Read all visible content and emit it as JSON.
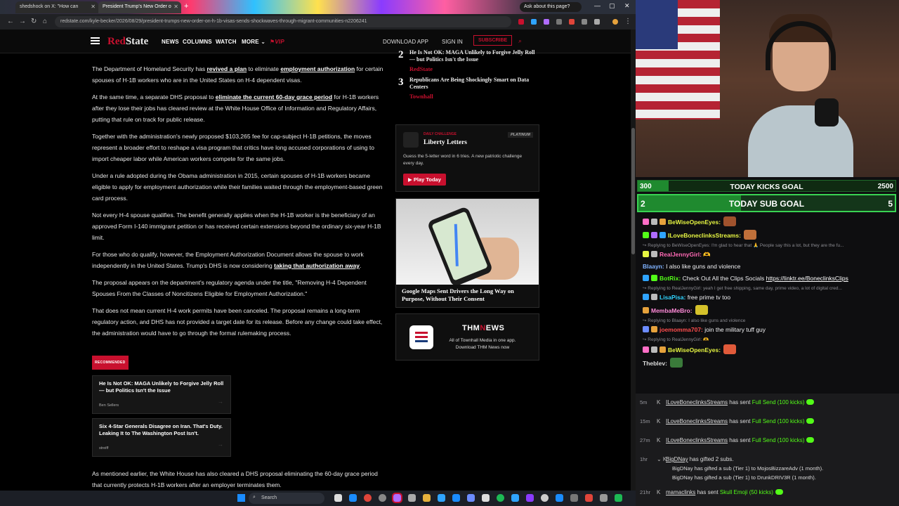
{
  "browser": {
    "tabs": [
      {
        "label": "shedshock on X: \"How can"
      },
      {
        "label": "President Trump's New Order o"
      }
    ],
    "new_tab": "+",
    "ask_pill": "Ask about this page?",
    "url": "redstate.com/kyle-becker/2026/08/29/president-trumps-new-order-on-h-1b-visas-sends-shockwaves-through-migrant-communities-n2206241",
    "window_controls": {
      "minimize": "—",
      "maximize": "▢",
      "close": "✕"
    }
  },
  "site": {
    "logo_red": "Red",
    "logo_white": "State",
    "nav": [
      "NEWS",
      "COLUMNS",
      "WATCH",
      "MORE"
    ],
    "vip": "VIP",
    "download_app": "DOWNLOAD APP",
    "sign_in": "SIGN IN",
    "subscribe": "SUBSCRIBE"
  },
  "article": {
    "p1_a": "The Department of Homeland Security has ",
    "p1_link1": "revived a plan",
    "p1_b": " to eliminate ",
    "p1_link2": "employment authorization",
    "p1_c": " for certain spouses of H-1B workers who are in the United States on H-4 dependent visas.",
    "p2_a": "At the same time, a separate DHS proposal to ",
    "p2_link": "eliminate the current 60-day grace period",
    "p2_b": " for H-1B workers after they lose their jobs has cleared review at the White House Office of Information and Regulatory Affairs, putting that rule on track for public release.",
    "p3": "Together with the administration's newly proposed $103,265 fee for cap-subject H-1B petitions, the moves represent a broader effort to reshape a visa program that critics have long accused corporations of using to import cheaper labor while American workers compete for the same jobs.",
    "p4": "Under a rule adopted during the Obama administration in 2015, certain spouses of H-1B workers became eligible to apply for employment authorization while their families waited through the employment-based green card process.",
    "p5": "Not every H-4 spouse qualifies. The benefit generally applies when the H-1B worker is the beneficiary of an approved Form I-140 immigrant petition or has received certain extensions beyond the ordinary six-year H-1B limit.",
    "p6_a": "For those who do qualify, however, the Employment Authorization Document allows the spouse to work independently in the United States. Trump's DHS is now considering ",
    "p6_link": "taking that authorization away",
    "p6_b": ".",
    "p7": "The proposal appears on the department's regulatory agenda under the title, \"Removing H-4 Dependent Spouses From the Classes of Noncitizens Eligible for Employment Authorization.\"",
    "p8": "That does not mean current H-4 work permits have been canceled. The proposal remains a long-term regulatory action, and DHS has not provided a target date for its release. Before any change could take effect, the administration would have to go through the formal rulemaking process.",
    "recommended_badge": "RECOMMENDED",
    "recommended": [
      {
        "title": "He Is Not OK: MAGA Unlikely to Forgive Jelly Roll — but Politics Isn't the Issue",
        "author": "Ben Sellers"
      },
      {
        "title": "Six 4-Star Generals Disagree on Iran. That's Duty. Leaking It to The Washington Post Isn't.",
        "author": "streiff"
      }
    ],
    "after_rec": "As mentioned earlier, the White House has also cleared a DHS proposal eliminating the 60-day grace period that currently protects H-1B workers after an employer terminates them."
  },
  "rail": {
    "trending": [
      {
        "num": "2",
        "headline": "He Is Not OK: MAGA Unlikely to Forgive Jelly Roll — but Politics Isn't the Issue",
        "source": "RedState"
      },
      {
        "num": "3",
        "headline": "Republicans Are Being Shockingly Smart on Data Centers",
        "source": "Townhall"
      }
    ],
    "liberty": {
      "kicker": "DAILY CHALLENGE",
      "title": "Liberty Letters",
      "platinum": "PLATINUM",
      "desc": "Guess the 5-letter word in 6 tries. A new patriotic challenge every day.",
      "play": "▶ Play Today"
    },
    "map_story": "Google Maps Sent Drivers the Long Way on Purpose, Without Their Consent",
    "thm": {
      "name_a": "THM",
      "name_b": "N",
      "name_c": "EWS",
      "tagline": "All of Townhall Media in one app. Download THM News now"
    }
  },
  "stream": {
    "kicks_goal": {
      "current": "300",
      "label": "TODAY KICKS GOAL",
      "target": "2500",
      "progress": 0.12
    },
    "sub_goal": {
      "current": "2",
      "label": "TODAY SUB GOAL",
      "target": "5",
      "progress": 0.4
    },
    "chat": [
      {
        "type": "msg",
        "user": "BeWiseOpenEyes:",
        "text": "",
        "color": "#e6f542",
        "badges": [
          "#ff6ec7",
          "#bbbbbb",
          "#e6a23c"
        ],
        "emote": "#a0522d"
      },
      {
        "type": "msg",
        "user": "ILoveBoneclinksStreams:",
        "text": "",
        "color": "#e6f542",
        "badges": [
          "#53fc18",
          "#b06cff",
          "#2fa4ff"
        ],
        "emote": "#c0703a"
      },
      {
        "type": "reply",
        "text": "Replying to BeWiseOpenEyes: I'm glad to hear that 🙏 People say this a lot, but they are the fu..."
      },
      {
        "type": "msg",
        "user": "RealJennyGirl:",
        "text": "🫶",
        "color": "#ff69b4",
        "badges": [
          "#e6f542",
          "#bbbbbb"
        ]
      },
      {
        "type": "msg",
        "user": "Blaayn:",
        "text": "I also like guns and violence",
        "color": "#7fb2ff",
        "badges": []
      },
      {
        "type": "msg",
        "user": "BotRix:",
        "text": "Check Out All the Clips Socials ",
        "link": "https://linktr.ee/BoneclinksClips",
        "color": "#53fc18",
        "badges": [
          "#2fa4ff",
          "#53fc18"
        ]
      },
      {
        "type": "reply",
        "text": "Replying to RealJennyGirl: yeah I get free shipping, same day, prime video, a lot of digital cred..."
      },
      {
        "type": "msg",
        "user": "LisaPisa:",
        "text": "free prime tv too",
        "color": "#2fd4ff",
        "badges": [
          "#2fa4ff",
          "#bbbbbb"
        ]
      },
      {
        "type": "msg",
        "user": "MembaMeBro:",
        "text": "",
        "color": "#ff8ad8",
        "badges": [
          "#e6a23c"
        ],
        "emote": "#d4c12a"
      },
      {
        "type": "reply",
        "text": "Replying to Blaayn: I also like guns and violence"
      },
      {
        "type": "msg",
        "user": "joemomma707:",
        "text": "join the military tuff guy",
        "color": "#ff4d4d",
        "badges": [
          "#6c8cff",
          "#e6a23c"
        ]
      },
      {
        "type": "reply",
        "text": "Replying to RealJennyGirl: 🫶"
      },
      {
        "type": "msg",
        "user": "BeWiseOpenEyes:",
        "text": "",
        "color": "#e6f542",
        "badges": [
          "#ff6ec7",
          "#bbbbbb",
          "#e6a23c"
        ],
        "emote": "#e05a3a"
      },
      {
        "type": "msg",
        "user": "Theblev:",
        "text": "",
        "color": "#dddddd",
        "badges": [],
        "emote": "#3a7a3a"
      }
    ],
    "events": [
      {
        "time": "5m",
        "user": "ILoveBoneclinksStreams",
        "text": " has sent ",
        "gift": "Full Send (100 kicks)"
      },
      {
        "time": "15m",
        "user": "ILoveBoneclinksStreams",
        "text": " has sent ",
        "gift": "Full Send (100 kicks)"
      },
      {
        "time": "27m",
        "user": "ILoveBoneclinksStreams",
        "text": " has sent ",
        "gift": "Full Send (100 kicks)"
      },
      {
        "time": "1hr",
        "user": "BigDNay",
        "text": " has gifted 2 subs.",
        "subs": [
          "BigDNay has gifted a sub (Tier 1) to MojosBizzareAdv (1 month).",
          "BigDNay has gifted a sub (Tier 1) to DrunkDRIV3R (1 month)."
        ]
      },
      {
        "time": "21hr",
        "user": "mamaclinks",
        "text": " has sent ",
        "gift": "Skull Emoji (50 kicks)"
      }
    ]
  },
  "taskbar": {
    "search": "Search"
  }
}
